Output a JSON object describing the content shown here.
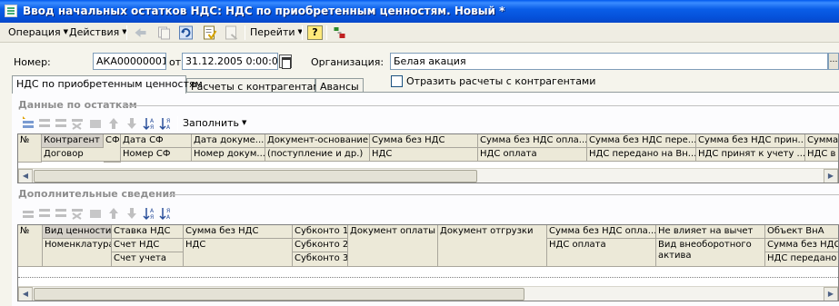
{
  "window": {
    "title": "Ввод начальных остатков НДС: НДС по приобретенным ценностям. Новый *"
  },
  "menu": {
    "operation": "Операция",
    "actions": "Действия",
    "goto": "Перейти",
    "help_symbol": "?"
  },
  "form": {
    "number_label": "Номер:",
    "number_value": "АКА00000001",
    "date_label": "от:",
    "date_value": "31.12.2005  0:00:00",
    "org_label": "Организация:",
    "org_value": "Белая акация",
    "reflect_label": "Отразить расчеты с контрагентами"
  },
  "tabs": [
    "НДС по приобретенным ценностям",
    "Расчеты с контрагентами",
    "Авансы"
  ],
  "balances": {
    "title": "Данные по остаткам",
    "fill_label": "Заполнить",
    "columns_row1": [
      "№",
      "Контрагент",
      "СФ",
      "Дата СФ",
      "Дата докуме...",
      "Документ-основание",
      "Сумма без НДС",
      "Сумма без НДС опла...",
      "Сумма без НДС пере...",
      "Сумма без НДС прин...",
      "Сумма"
    ],
    "columns_row2": [
      "Договор",
      "Номер СФ",
      "Номер докум...",
      "(поступление и др.)",
      "НДС",
      "НДС оплата",
      "НДС передано на Вн...",
      "НДС принят к учету ...",
      "НДС в"
    ]
  },
  "additional": {
    "title": "Дополнительные сведения",
    "columns_row1": [
      "№",
      "Вид ценности",
      "Ставка НДС",
      "Сумма без НДС",
      "Субконто 1",
      "Документ оплаты",
      "Документ отгрузки",
      "Сумма без НДС опла...",
      "Не влияет на вычет",
      "Объект ВнА"
    ],
    "col_r2": {
      "nomen": "Номенклатура",
      "schet_nds": "Счет НДС",
      "nds": "НДС",
      "subkonto2": "Субконто 2",
      "nds_oplata": "НДС оплата",
      "vid_vna": "Вид внеоборотного актива",
      "summa_bez_nds": "Сумма без НДС",
      "nds_peredano": "НДС передано"
    },
    "col_r3": {
      "schet_ucheta": "Счет учета",
      "subkonto3": "Субконто 3"
    }
  }
}
